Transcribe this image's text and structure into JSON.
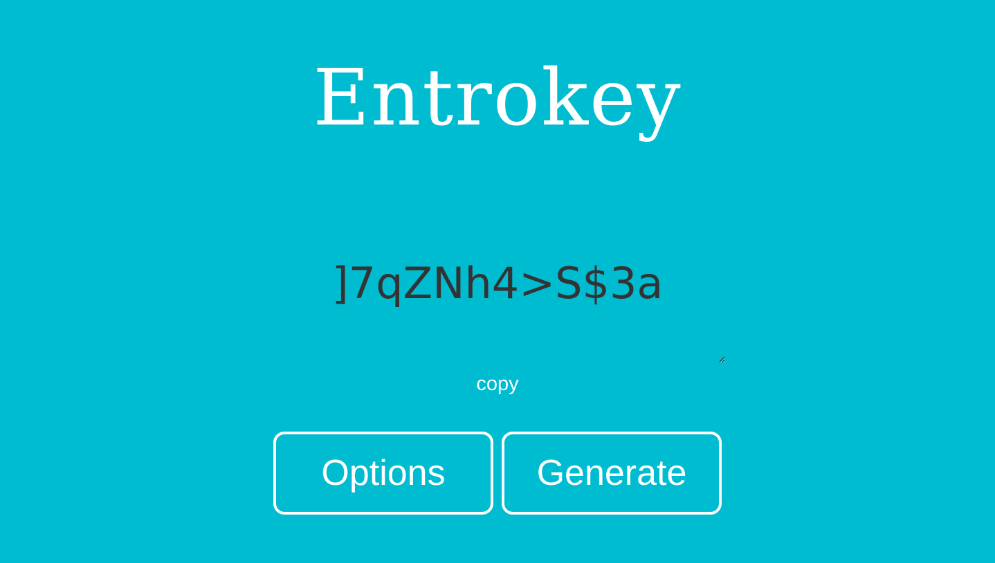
{
  "app": {
    "title": "Entrokey"
  },
  "password": {
    "value": "]7qZNh4>S$3a"
  },
  "copy": {
    "label": "copy"
  },
  "buttons": {
    "options_label": "Options",
    "generate_label": "Generate"
  },
  "colors": {
    "background": "#00bcd1",
    "text_light": "#ffffff",
    "password_text": "#333333"
  },
  "icons": {
    "resize_grip": "resize-grip-icon"
  }
}
